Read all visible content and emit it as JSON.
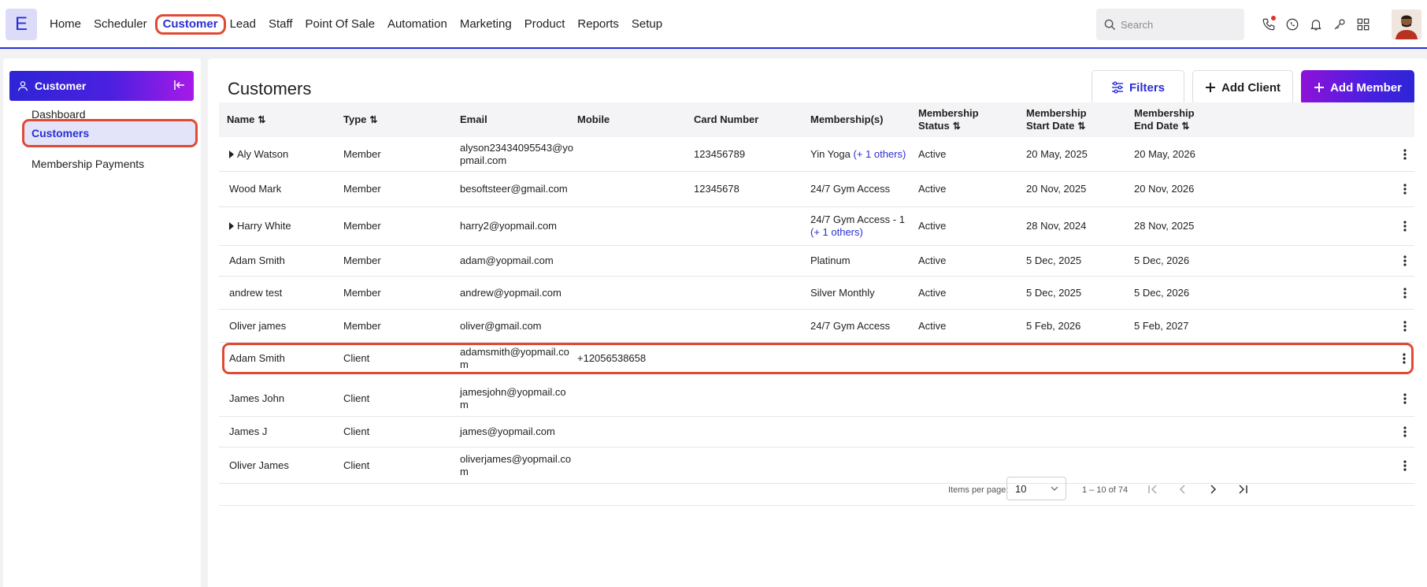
{
  "app": {
    "logo_letter": "E",
    "accent_color": "#2a2fd0",
    "highlight_color": "#e04a35"
  },
  "nav": {
    "items": [
      {
        "label": "Home"
      },
      {
        "label": "Scheduler"
      },
      {
        "label": "Customer"
      },
      {
        "label": "Lead"
      },
      {
        "label": "Staff"
      },
      {
        "label": "Point Of Sale"
      },
      {
        "label": "Automation"
      },
      {
        "label": "Marketing"
      },
      {
        "label": "Product"
      },
      {
        "label": "Reports"
      },
      {
        "label": "Setup"
      }
    ],
    "active": "Customer",
    "search_placeholder": "Search",
    "icons": [
      "phone-icon",
      "whatsapp-icon",
      "bell-icon",
      "key-icon",
      "grid-icon",
      "user-avatar"
    ]
  },
  "sidebar": {
    "title": "Customer",
    "links": [
      {
        "label": "Dashboard"
      },
      {
        "label": "Customers"
      },
      {
        "label": "Membership Payments"
      }
    ],
    "active": "Customers"
  },
  "main": {
    "title": "Customers",
    "buttons": {
      "filters": "Filters",
      "add_client": "Add Client",
      "add_member": "Add Member"
    },
    "columns": [
      {
        "label": "Name",
        "sortable": true
      },
      {
        "label": "Type",
        "sortable": true
      },
      {
        "label": "Email",
        "sortable": false
      },
      {
        "label": "Mobile",
        "sortable": false
      },
      {
        "label": "Card Number",
        "sortable": false
      },
      {
        "label": "Membership(s)",
        "sortable": false
      },
      {
        "label": "Membership Status",
        "line1": "Membership",
        "line2": "Status",
        "sortable": true
      },
      {
        "label": "Membership Start Date",
        "line1": "Membership",
        "line2": "Start Date",
        "sortable": true
      },
      {
        "label": "Membership End Date",
        "line1": "Membership",
        "line2": "End Date",
        "sortable": true
      }
    ],
    "rows": [
      {
        "name": "Aly Watson",
        "expand": true,
        "type": "Member",
        "email": "alyson23434095543@yo",
        "email2": "pmail.com",
        "mobile": "",
        "card": "123456789",
        "membership": "Yin Yoga",
        "membership_more": "(+ 1 others)",
        "membership_more_inline": true,
        "status": "Active",
        "start": "20 May, 2025",
        "end": "20 May, 2026"
      },
      {
        "name": "Wood Mark",
        "expand": false,
        "type": "Member",
        "email": "besoftsteer@gmail.com",
        "email2": "",
        "mobile": "",
        "card": "12345678",
        "membership": "24/7 Gym Access",
        "membership_more": "",
        "membership_more_inline": false,
        "status": "Active",
        "start": "20 Nov, 2025",
        "end": "20 Nov, 2026"
      },
      {
        "name": "Harry White",
        "expand": true,
        "type": "Member",
        "email": "harry2@yopmail.com",
        "email2": "",
        "mobile": "",
        "card": "",
        "membership": "24/7 Gym Access - 1",
        "membership_more": "(+ 1 others)",
        "membership_more_inline": false,
        "status": "Active",
        "start": "28 Nov, 2024",
        "end": "28 Nov, 2025"
      },
      {
        "name": "Adam Smith",
        "expand": false,
        "type": "Member",
        "email": "adam@yopmail.com",
        "email2": "",
        "mobile": "",
        "card": "",
        "membership": "Platinum",
        "membership_more": "",
        "membership_more_inline": false,
        "status": "Active",
        "start": "5 Dec, 2025",
        "end": "5 Dec, 2026"
      },
      {
        "name": "andrew test",
        "expand": false,
        "type": "Member",
        "email": "andrew@yopmail.com",
        "email2": "",
        "mobile": "",
        "card": "",
        "membership": "Silver Monthly",
        "membership_more": "",
        "membership_more_inline": false,
        "status": "Active",
        "start": "5 Dec, 2025",
        "end": "5 Dec, 2026"
      },
      {
        "name": "Oliver james",
        "expand": false,
        "type": "Member",
        "email": "oliver@gmail.com",
        "email2": "",
        "mobile": "",
        "card": "",
        "membership": "24/7 Gym Access",
        "membership_more": "",
        "membership_more_inline": false,
        "status": "Active",
        "start": "5 Feb, 2026",
        "end": "5 Feb, 2027"
      },
      {
        "name": "Adam Smith",
        "expand": false,
        "type": "Client",
        "email": "adamsmith@yopmail.co",
        "email2": "m",
        "mobile": "+12056538658",
        "card": "",
        "membership": "",
        "membership_more": "",
        "membership_more_inline": false,
        "status": "",
        "start": "",
        "end": "",
        "highlighted": true
      },
      {
        "name": "James John",
        "expand": false,
        "type": "Client",
        "email": "jamesjohn@yopmail.co",
        "email2": "m",
        "mobile": "",
        "card": "",
        "membership": "",
        "membership_more": "",
        "membership_more_inline": false,
        "status": "",
        "start": "",
        "end": ""
      },
      {
        "name": "James J",
        "expand": false,
        "type": "Client",
        "email": "james@yopmail.com",
        "email2": "",
        "mobile": "",
        "card": "",
        "membership": "",
        "membership_more": "",
        "membership_more_inline": false,
        "status": "",
        "start": "",
        "end": ""
      },
      {
        "name": "Oliver James",
        "expand": false,
        "type": "Client",
        "email": "oliverjames@yopmail.co",
        "email2": "m",
        "mobile": "",
        "card": "",
        "membership": "",
        "membership_more": "",
        "membership_more_inline": false,
        "status": "",
        "start": "",
        "end": ""
      }
    ],
    "pagination": {
      "items_per_page_label": "Items per page:",
      "items_per_page": "10",
      "range": "1 – 10 of 74"
    }
  }
}
